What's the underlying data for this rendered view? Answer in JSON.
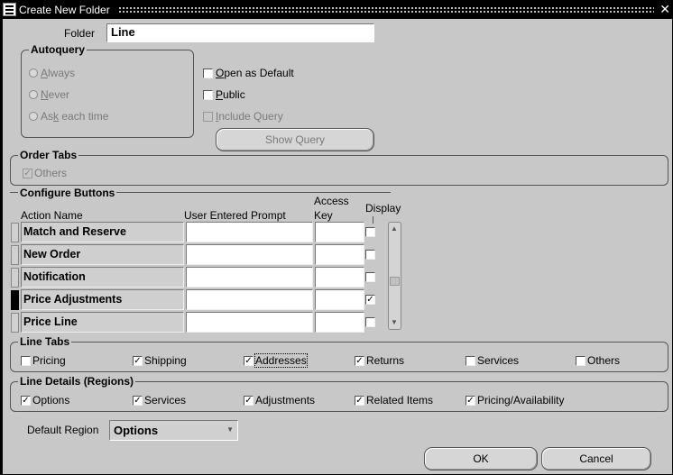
{
  "window": {
    "title": "Create New Folder",
    "close_glyph": "✕"
  },
  "folder": {
    "label": "Folder",
    "value": "Line"
  },
  "autoquery": {
    "title": "Autoquery",
    "options": [
      {
        "label": "Always",
        "selected": false
      },
      {
        "label": "Never",
        "selected": false
      },
      {
        "label": "Ask each time",
        "selected": false
      }
    ]
  },
  "folder_options": {
    "open_as_default": {
      "label": "Open as Default",
      "checked": false
    },
    "public": {
      "label": "Public",
      "checked": false
    },
    "include_query": {
      "label": "Include Query",
      "checked": false
    },
    "show_query": "Show Query"
  },
  "order_tabs": {
    "title": "Order Tabs",
    "others": {
      "label": "Others",
      "checked": true
    }
  },
  "configure_buttons": {
    "title": "Configure Buttons",
    "columns": {
      "action_name": "Action Name",
      "prompt": "User Entered Prompt",
      "access_key_1": "Access",
      "access_key_2": "Key",
      "display": "Display"
    },
    "rows": [
      {
        "action": "Match and Reserve",
        "prompt": "",
        "key": "",
        "display": false,
        "current": false
      },
      {
        "action": "New Order",
        "prompt": "",
        "key": "",
        "display": false,
        "current": false
      },
      {
        "action": "Notification",
        "prompt": "",
        "key": "",
        "display": false,
        "current": false
      },
      {
        "action": "Price Adjustments",
        "prompt": "",
        "key": "",
        "display": true,
        "current": true
      },
      {
        "action": "Price Line",
        "prompt": "",
        "key": "",
        "display": false,
        "current": false
      }
    ]
  },
  "line_tabs": {
    "title": "Line Tabs",
    "items": [
      {
        "label": "Pricing",
        "checked": false
      },
      {
        "label": "Shipping",
        "checked": true
      },
      {
        "label": "Addresses",
        "checked": true
      },
      {
        "label": "Returns",
        "checked": true
      },
      {
        "label": "Services",
        "checked": false
      },
      {
        "label": "Others",
        "checked": false
      }
    ]
  },
  "line_details": {
    "title": "Line Details (Regions)",
    "items": [
      {
        "label": "Options",
        "checked": true
      },
      {
        "label": "Services",
        "checked": true
      },
      {
        "label": "Adjustments",
        "checked": true
      },
      {
        "label": "Related Items",
        "checked": true
      },
      {
        "label": "Pricing/Availability",
        "checked": true
      }
    ]
  },
  "default_region": {
    "label": "Default Region",
    "value": "Options"
  },
  "buttons": {
    "ok": "OK",
    "cancel": "Cancel"
  },
  "glyphs": {
    "check": "✓",
    "arrow_up": "▲",
    "arrow_down": "▼",
    "dropdown": "▼"
  }
}
